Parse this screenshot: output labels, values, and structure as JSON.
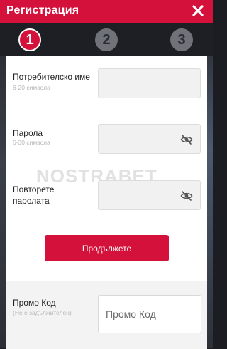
{
  "header": {
    "title": "Регистрация",
    "close_icon": "close-icon"
  },
  "steps": [
    {
      "label": "1",
      "state": "active"
    },
    {
      "label": "2",
      "state": "inactive"
    },
    {
      "label": "3",
      "state": "inactive"
    }
  ],
  "form": {
    "username": {
      "label": "Потребителско име",
      "hint": "6-20 символа",
      "value": ""
    },
    "password": {
      "label": "Парола",
      "hint": "6-30 символа",
      "value": "",
      "icon": "eye-slash-icon"
    },
    "password_repeat": {
      "label_line1": "Повторете",
      "label_line2": "паролата",
      "value": "",
      "icon": "eye-slash-icon"
    },
    "submit_label": "Продължете"
  },
  "watermark": "NOSTRABET",
  "promo": {
    "label": "Промо Код",
    "hint": "(Не е задължителен)",
    "placeholder": "Промо Код"
  },
  "colors": {
    "accent": "#d3113b",
    "dark": "#1d1f24",
    "step_inactive": "#6f7278"
  }
}
